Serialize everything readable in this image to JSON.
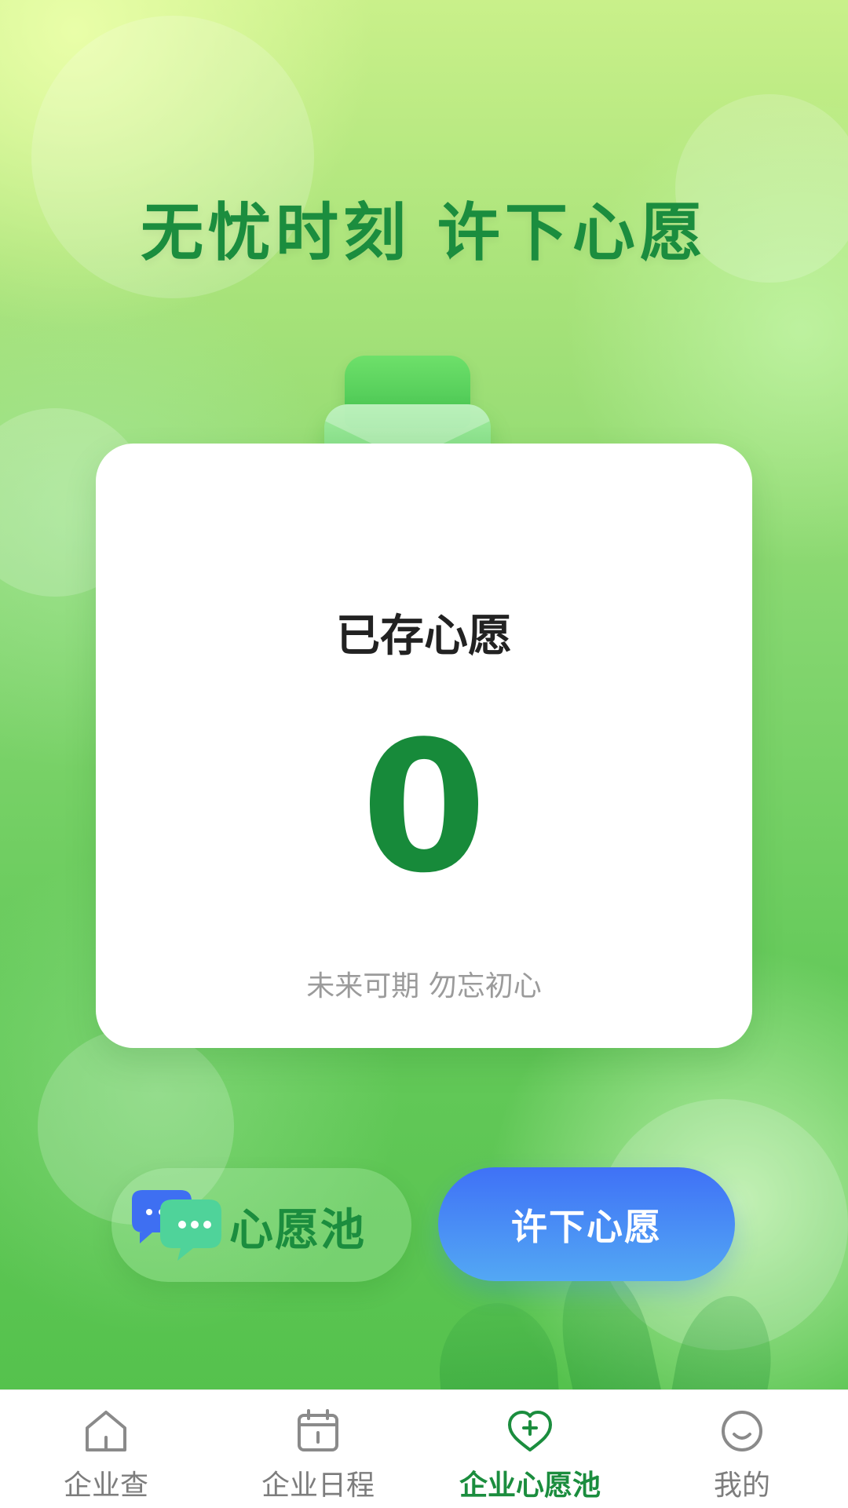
{
  "header": {
    "title": "无忧时刻 许下心愿"
  },
  "wish_card": {
    "label": "已存心愿",
    "count": 0,
    "subtitle": "未来可期 勿忘初心"
  },
  "actions": {
    "wish_pool_label": "心愿池",
    "make_wish_label": "许下心愿"
  },
  "bottom_nav": {
    "items": [
      {
        "label": "企业查",
        "icon": "home-icon",
        "active": false
      },
      {
        "label": "企业日程",
        "icon": "calendar-icon",
        "active": false
      },
      {
        "label": "企业心愿池",
        "icon": "heart-plus-icon",
        "active": true
      },
      {
        "label": "我的",
        "icon": "smile-icon",
        "active": false
      }
    ]
  },
  "colors": {
    "primary_green": "#1b8d3e",
    "accent_blue_top": "#3f71f6",
    "accent_blue_bottom": "#53a8f4",
    "nav_inactive": "#7d7d7d"
  }
}
